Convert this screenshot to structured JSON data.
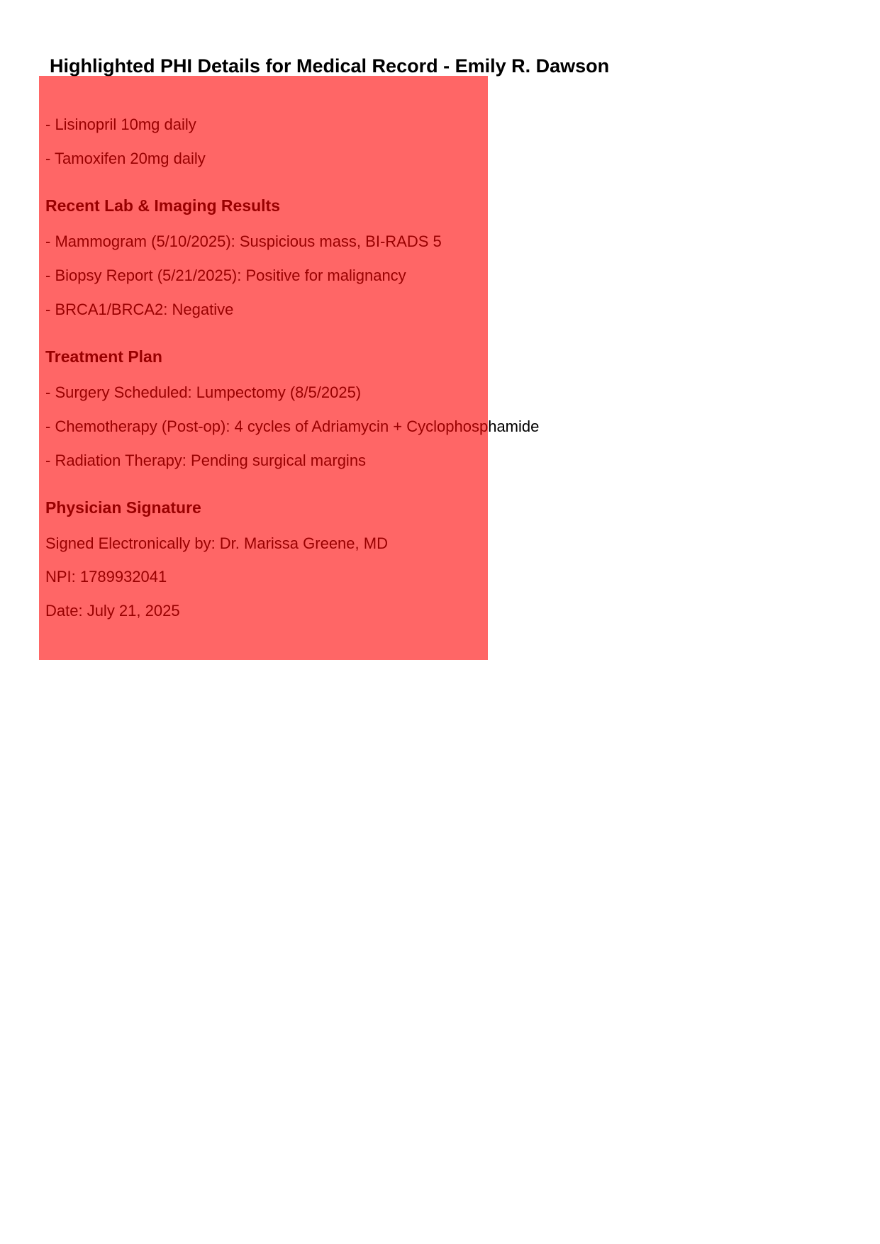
{
  "document": {
    "title": "Highlighted PHI Details for Medical Record - Emily R. Dawson"
  },
  "medications": {
    "items": [
      "- Lisinopril 10mg daily",
      "- Tamoxifen 20mg daily"
    ]
  },
  "lab_results": {
    "heading": "Recent Lab & Imaging Results",
    "items": [
      "- Mammogram (5/10/2025): Suspicious mass, BI-RADS 5",
      "- Biopsy Report (5/21/2025): Positive for malignancy",
      "- BRCA1/BRCA2: Negative"
    ]
  },
  "treatment_plan": {
    "heading": "Treatment Plan",
    "items": [
      "- Surgery Scheduled: Lumpectomy (8/5/2025)",
      "- Chemotherapy (Post-op): 4 cycles of Adriamycin + Cyclophosphamide",
      "- Radiation Therapy: Pending surgical margins"
    ]
  },
  "signature": {
    "heading": "Physician Signature",
    "signed_by": "Signed Electronically by: Dr. Marissa Greene, MD",
    "npi": "NPI: 1789932041",
    "date": "Date: July 21, 2025"
  },
  "highlight": {
    "color": "#ff0000"
  }
}
